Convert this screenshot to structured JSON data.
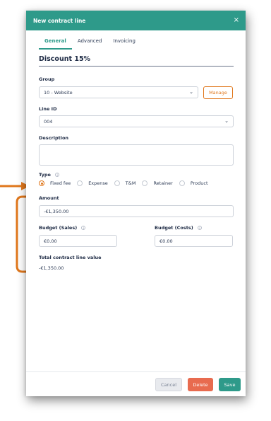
{
  "modal": {
    "title": "New contract line",
    "close_glyph": "×"
  },
  "tabs": [
    {
      "label": "General",
      "active": true
    },
    {
      "label": "Advanced",
      "active": false
    },
    {
      "label": "Invoicing",
      "active": false
    }
  ],
  "section": {
    "title": "Discount 15%"
  },
  "group": {
    "label": "Group",
    "value": "10 - Website",
    "manage_label": "Manage"
  },
  "line_id": {
    "label": "Line ID",
    "value": "004"
  },
  "description": {
    "label": "Description",
    "value": ""
  },
  "type": {
    "label": "Type",
    "options": [
      {
        "label": "Fixed fee",
        "checked": true
      },
      {
        "label": "Expense",
        "checked": false
      },
      {
        "label": "T&M",
        "checked": false
      },
      {
        "label": "Retainer",
        "checked": false
      },
      {
        "label": "Product",
        "checked": false
      }
    ]
  },
  "amount": {
    "label": "Amount",
    "value": "-€1,350.00"
  },
  "budget_sales": {
    "label": "Budget (Sales)",
    "value": "€0.00"
  },
  "budget_costs": {
    "label": "Budget (Costs)",
    "value": "€0.00"
  },
  "total": {
    "label": "Total contract line value",
    "value": "-€1,350.00"
  },
  "buttons": {
    "cancel": "Cancel",
    "delete": "Delete",
    "save": "Save"
  },
  "colors": {
    "accent": "#2e9a8a",
    "orange": "#e0771c",
    "delete": "#e86b4f"
  },
  "icons": {
    "close": "close-icon",
    "chevron": "chevron-down-icon",
    "info": "info-icon"
  }
}
